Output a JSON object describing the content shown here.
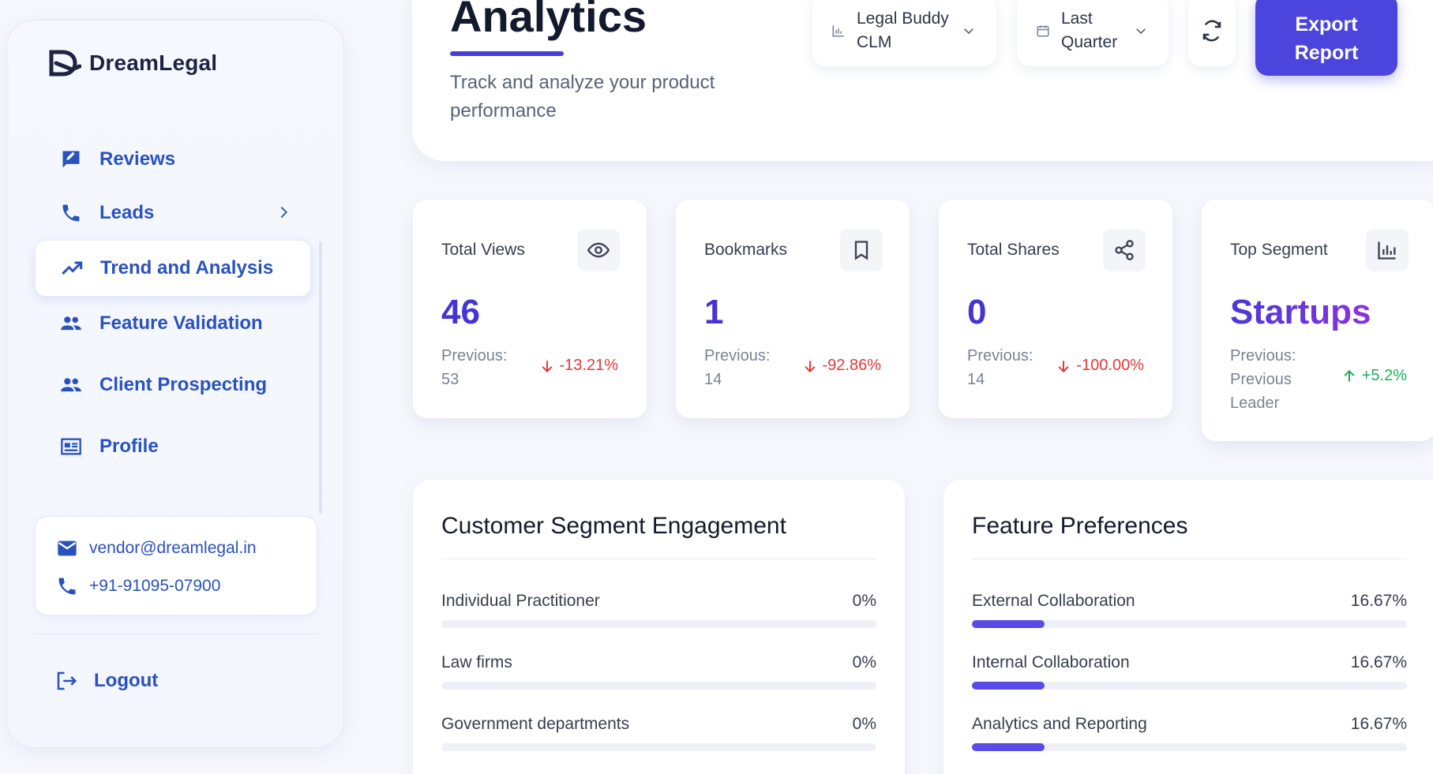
{
  "brand": {
    "name": "DreamLegal"
  },
  "sidebar": {
    "items": [
      {
        "label": "Reviews"
      },
      {
        "label": "Leads"
      },
      {
        "label": "Trend and Analysis"
      },
      {
        "label": "Feature Validation"
      },
      {
        "label": "Client Prospecting"
      },
      {
        "label": "Profile"
      }
    ],
    "active": "Trend and Analysis",
    "contact": {
      "email": "vendor@dreamlegal.in",
      "phone": "+91-91095-07900"
    },
    "logout_label": "Logout"
  },
  "header": {
    "title": "Analytics",
    "subtitle": "Track and analyze your product performance",
    "product_select": {
      "value": "Legal Buddy CLM",
      "line1": "Legal Buddy",
      "line2": "CLM"
    },
    "period_select": {
      "value": "Last Quarter",
      "line1": "Last",
      "line2": "Quarter"
    },
    "export": {
      "line1": "Export",
      "line2": "Report"
    }
  },
  "stats": [
    {
      "title": "Total Views",
      "icon": "eye-icon",
      "value": "46",
      "previous_label": "Previous:",
      "previous_value": "53",
      "change": "-13.21%",
      "direction": "down"
    },
    {
      "title": "Bookmarks",
      "icon": "bookmark-icon",
      "value": "1",
      "previous_label": "Previous:",
      "previous_value": "14",
      "change": "-92.86%",
      "direction": "down"
    },
    {
      "title": "Total Shares",
      "icon": "share-icon",
      "value": "0",
      "previous_label": "Previous:",
      "previous_value": "14",
      "change": "-100.00%",
      "direction": "down"
    },
    {
      "title": "Top Segment",
      "icon": "bar-chart-icon",
      "value": "Startups",
      "previous_label": "Previous:",
      "previous_value": "Previous Leader",
      "change": "+5.2%",
      "direction": "up"
    }
  ],
  "segment_engagement": {
    "title": "Customer Segment Engagement",
    "rows": [
      {
        "name": "Individual Practitioner",
        "pct": "0%",
        "value": 0
      },
      {
        "name": "Law firms",
        "pct": "0%",
        "value": 0
      },
      {
        "name": "Government departments",
        "pct": "0%",
        "value": 0
      }
    ]
  },
  "feature_preferences": {
    "title": "Feature Preferences",
    "rows": [
      {
        "name": "External Collaboration",
        "pct": "16.67%",
        "value": 16.67
      },
      {
        "name": "Internal Collaboration",
        "pct": "16.67%",
        "value": 16.67
      },
      {
        "name": "Analytics and Reporting",
        "pct": "16.67%",
        "value": 16.67
      }
    ]
  },
  "colors": {
    "accent": "#4b44dd",
    "nav_text": "#2a52be",
    "negative": "#e23a3a",
    "positive": "#1db257",
    "bar_fill": "#5b4be6"
  }
}
